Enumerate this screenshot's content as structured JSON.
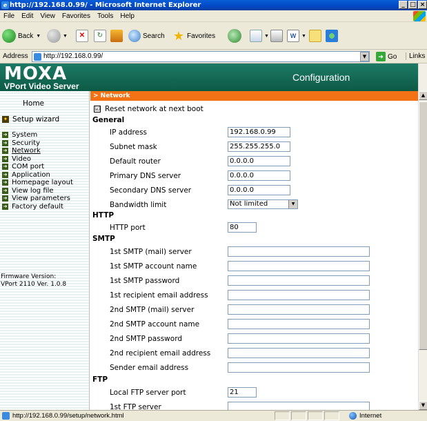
{
  "window": {
    "title": "http://192.168.0.99/ - Microsoft Internet Explorer"
  },
  "menu": [
    "File",
    "Edit",
    "View",
    "Favorites",
    "Tools",
    "Help"
  ],
  "toolbar": {
    "back": "Back",
    "search": "Search",
    "favorites": "Favorites"
  },
  "address": {
    "label": "Address",
    "url": "http://192.168.0.99/",
    "go": "Go",
    "links": "Links"
  },
  "header": {
    "brand": "MOXA",
    "product": "VPort Video Server",
    "title": "Configuration"
  },
  "sidebar": {
    "home": "Home",
    "wizard": "Setup wizard",
    "items": [
      "System",
      "Security",
      "Network",
      "Video",
      "COM port",
      "Application",
      "Homepage layout",
      "View log file",
      "View parameters",
      "Factory default"
    ],
    "firmware_label": "Firmware Version:",
    "firmware_value": "VPort 2110 Ver. 1.0.8"
  },
  "page": {
    "breadcrumb": "> Network",
    "reset": {
      "label": "Reset network at next boot",
      "checked": "☑"
    },
    "sections": {
      "general": "General",
      "http": "HTTP",
      "smtp": "SMTP",
      "ftp": "FTP"
    },
    "general": {
      "ip_label": "IP address",
      "ip_value": "192.168.0.99",
      "mask_label": "Subnet mask",
      "mask_value": "255.255.255.0",
      "router_label": "Default router",
      "router_value": "0.0.0.0",
      "dns1_label": "Primary DNS server",
      "dns1_value": "0.0.0.0",
      "dns2_label": "Secondary DNS server",
      "dns2_value": "0.0.0.0",
      "bw_label": "Bandwidth limit",
      "bw_value": "Not limited"
    },
    "http": {
      "port_label": "HTTP port",
      "port_value": "80"
    },
    "smtp": [
      "1st SMTP (mail) server",
      "1st SMTP account name",
      "1st SMTP password",
      "1st recipient email address",
      "2nd SMTP (mail) server",
      "2nd SMTP account name",
      "2nd SMTP password",
      "2nd recipient email address",
      "Sender email address"
    ],
    "ftp": {
      "port_label": "Local FTP server port",
      "port_value": "21",
      "server_label": "1st FTP server"
    }
  },
  "status": {
    "text": "http://192.168.0.99/setup/network.html",
    "zone": "Internet"
  }
}
